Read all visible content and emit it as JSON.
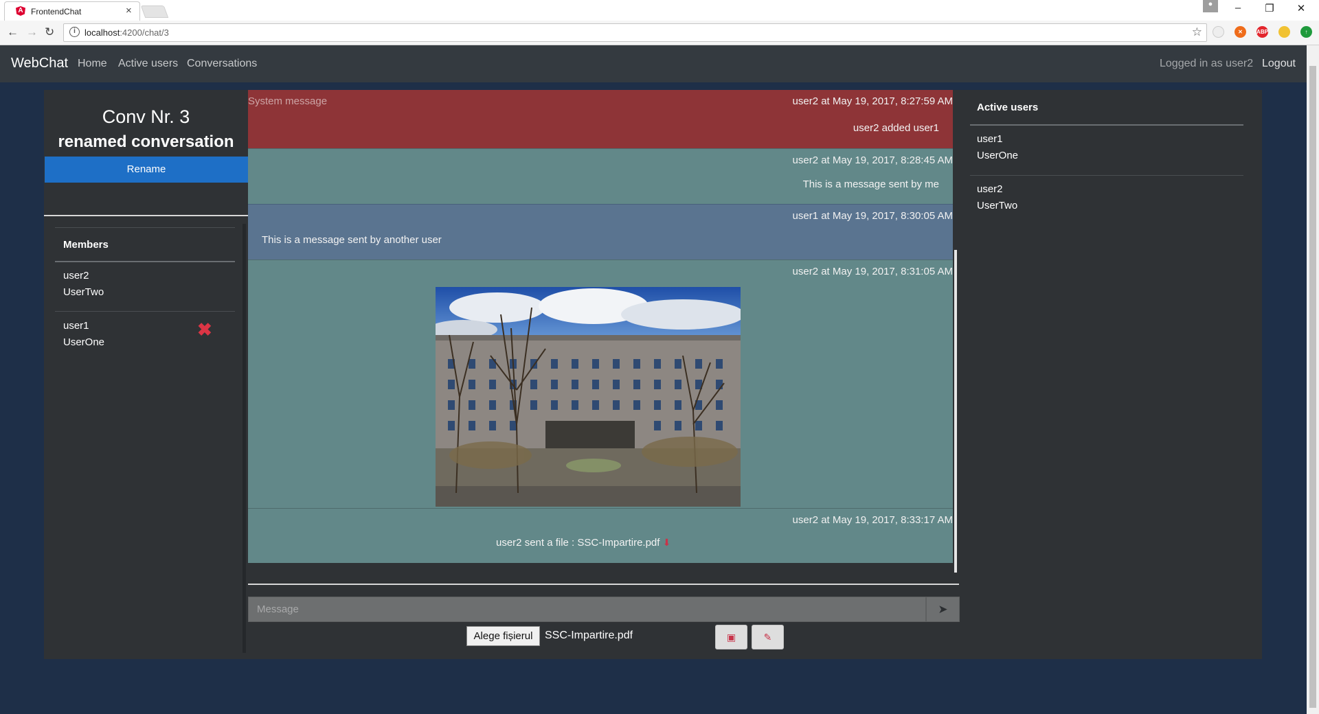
{
  "browser": {
    "tab_title": "FrontendChat",
    "tab_favicon_letter": "A",
    "url_host": "localhost",
    "url_path": ":4200/chat/3",
    "extensions": [
      {
        "name": "extension-icon-1",
        "color": "#eeeeee",
        "label": ""
      },
      {
        "name": "extension-icon-2",
        "color": "#ef6c1a",
        "label": ""
      },
      {
        "name": "adblock-icon",
        "color": "#e3262d",
        "label": "ABP"
      },
      {
        "name": "extension-icon-3",
        "color": "#f1c232",
        "label": ""
      },
      {
        "name": "extension-icon-4",
        "color": "#1f9a3c",
        "label": ""
      }
    ]
  },
  "navbar": {
    "brand": "WebChat",
    "links": [
      "Home",
      "Active users",
      "Conversations"
    ],
    "logged_in_text": "Logged in as user2",
    "logout": "Logout"
  },
  "conversation": {
    "title": "Conv Nr. 3",
    "name": "renamed conversation",
    "rename_label": "Rename",
    "members_heading": "Members",
    "members": [
      {
        "username": "user2",
        "display": "UserTwo",
        "removable": false
      },
      {
        "username": "user1",
        "display": "UserOne",
        "removable": true
      }
    ]
  },
  "messages": [
    {
      "type": "system",
      "label": "System message",
      "meta": "user2 at May 19, 2017, 8:27:59 AM",
      "text": "user2 added user1"
    },
    {
      "type": "me",
      "meta": "user2 at May 19, 2017, 8:28:45 AM",
      "text": "This is a message sent by me"
    },
    {
      "type": "other",
      "meta": "user1 at May 19, 2017, 8:30:05 AM",
      "text": "This is a message sent by another user"
    },
    {
      "type": "image",
      "meta": "user2 at May 19, 2017, 8:31:05 AM",
      "image_alt": "abandoned building photo"
    },
    {
      "type": "file",
      "meta": "user2 at May 19, 2017, 8:33:17 AM",
      "text": "user2 sent a file : SSC-Impartire.pdf"
    }
  ],
  "composer": {
    "placeholder": "Message",
    "choose_file_label": "Alege fișierul",
    "selected_file": "SSC-Impartire.pdf"
  },
  "active_users": {
    "heading": "Active users",
    "users": [
      {
        "username": "user1",
        "display": "UserOne"
      },
      {
        "username": "user2",
        "display": "UserTwo"
      }
    ]
  },
  "colors": {
    "navbar": "#343a40",
    "system_message": "#8e3437",
    "own_message": "#628889",
    "other_message": "#5a7490",
    "rename_button": "#1e6fc6",
    "danger": "#dc3545"
  }
}
